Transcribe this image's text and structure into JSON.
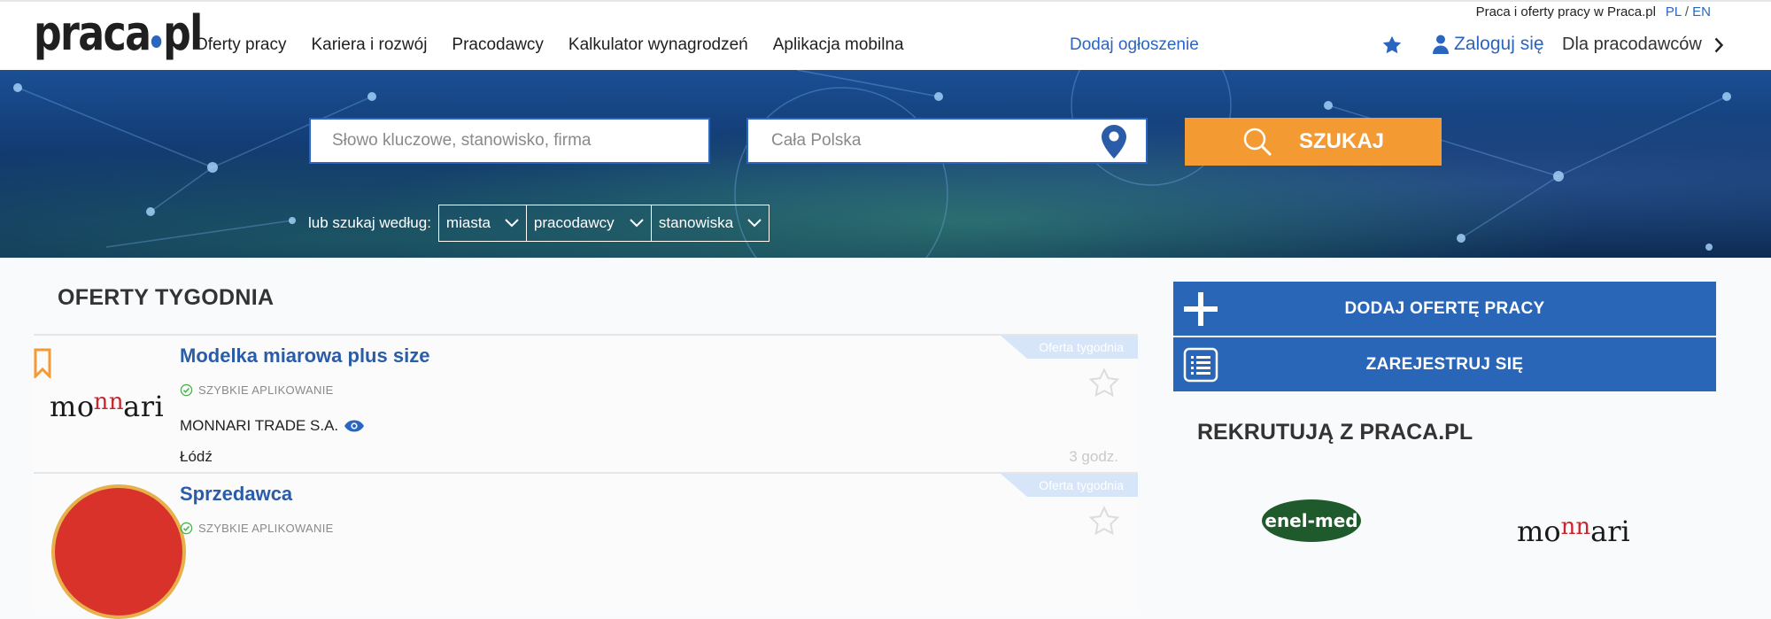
{
  "header": {
    "logo_text_left": "praca",
    "logo_text_right": "pl",
    "tagline": "Praca i oferty pracy w Praca.pl",
    "lang_pl": "PL",
    "lang_sep": "/",
    "lang_en": "EN",
    "nav": [
      "Oferty pracy",
      "Kariera i rozwój",
      "Pracodawcy",
      "Kalkulator wynagrodzeń",
      "Aplikacja mobilna"
    ],
    "add_ad": "Dodaj ogłoszenie",
    "login": "Zaloguj się",
    "employers": "Dla pracodawców"
  },
  "search": {
    "keyword_placeholder": "Słowo kluczowe, stanowisko, firma",
    "location_placeholder": "Cała Polska",
    "button": "SZUKAJ",
    "by_label": "lub szukaj według:",
    "selects": [
      "miasta",
      "pracodawcy",
      "stanowiska"
    ]
  },
  "offers_section": {
    "title": "OFERTY TYGODNIA",
    "ribbon": "Oferta tygodnia",
    "offers": [
      {
        "title": "Modelka miarowa plus size",
        "quick_apply": "SZYBKIE APLIKOWANIE",
        "company": "MONNARI TRADE S.A.",
        "city": "Łódź",
        "age": "3 godz."
      },
      {
        "title": "Sprzedawca",
        "quick_apply": "SZYBKIE APLIKOWANIE"
      }
    ]
  },
  "logo_monnari": {
    "a": "mo",
    "b": "nn",
    "c": "ari"
  },
  "sidebar": {
    "add_offer": "DODAJ OFERTĘ PRACY",
    "register": "ZAREJESTRUJ SIĘ",
    "recruiting_title": "REKRUTUJĄ Z PRACA.PL",
    "partner_1": "enel-med"
  },
  "colors": {
    "brand_blue": "#2a66b8",
    "accent_orange": "#f49a33",
    "link_blue": "#2a66c0"
  }
}
